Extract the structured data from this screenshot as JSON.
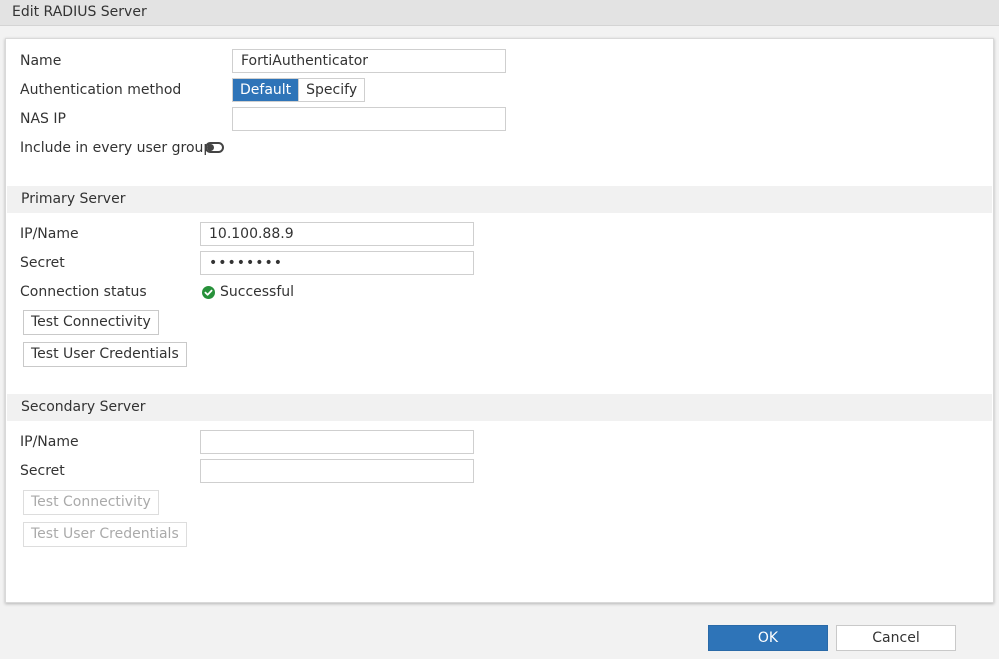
{
  "dialog": {
    "title": "Edit RADIUS Server"
  },
  "general": {
    "name_label": "Name",
    "name_value": "FortiAuthenticator",
    "auth_method_label": "Authentication method",
    "auth_method_options": [
      "Default",
      "Specify"
    ],
    "auth_method_selected": "Default",
    "nas_ip_label": "NAS IP",
    "nas_ip_value": "",
    "include_label": "Include in every user group",
    "include_enabled": false
  },
  "primary": {
    "heading": "Primary Server",
    "ip_label": "IP/Name",
    "ip_value": "10.100.88.9",
    "secret_label": "Secret",
    "secret_value": "••••••••",
    "conn_label": "Connection status",
    "conn_status": "Successful",
    "test_conn_button": "Test Connectivity",
    "test_user_button": "Test User Credentials"
  },
  "secondary": {
    "heading": "Secondary Server",
    "ip_label": "IP/Name",
    "ip_value": "",
    "secret_label": "Secret",
    "secret_value": "",
    "test_conn_button": "Test Connectivity",
    "test_user_button": "Test User Credentials"
  },
  "footer": {
    "ok_label": "OK",
    "cancel_label": "Cancel"
  },
  "colors": {
    "accent": "#2e74b8",
    "success": "#27913a"
  }
}
